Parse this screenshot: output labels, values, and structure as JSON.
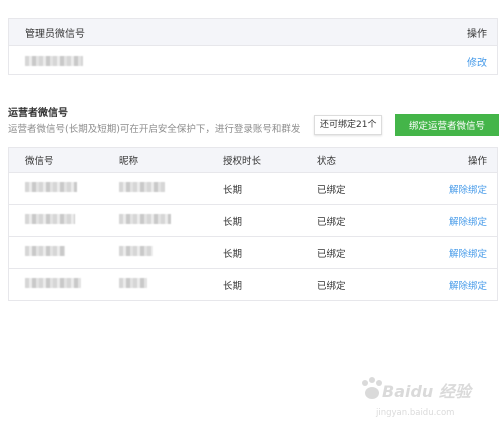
{
  "admin": {
    "header_label": "管理员微信号",
    "header_action": "操作",
    "row_action": "修改"
  },
  "operators": {
    "title": "运营者微信号",
    "description": "运营者微信号(长期及短期)可在开启安全保护下，进行登录账号和群发",
    "remaining_hint": "还可绑定21个",
    "bind_button": "绑定运营者微信号",
    "columns": [
      "微信号",
      "昵称",
      "授权时长",
      "状态",
      "操作"
    ],
    "rows": [
      {
        "duration": "长期",
        "status": "已绑定",
        "action": "解除绑定"
      },
      {
        "duration": "长期",
        "status": "已绑定",
        "action": "解除绑定"
      },
      {
        "duration": "长期",
        "status": "已绑定",
        "action": "解除绑定"
      },
      {
        "duration": "长期",
        "status": "已绑定",
        "action": "解除绑定"
      }
    ]
  },
  "watermark": {
    "brand": "Baidu 经验",
    "url": "jingyan.baidu.com"
  },
  "colors": {
    "accent_green": "#44b549",
    "link_blue": "#459ae9",
    "header_bg": "#f4f5f9",
    "border": "#e7e7eb"
  }
}
